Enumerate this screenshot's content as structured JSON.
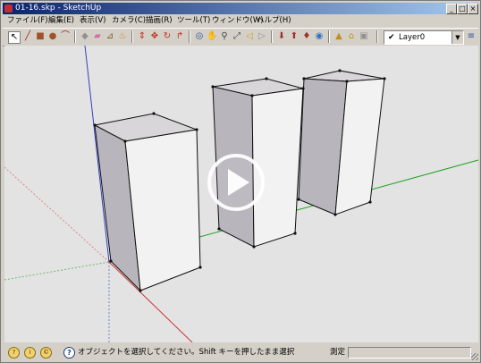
{
  "window": {
    "title": "01-16.skp - SketchUp",
    "minimize": "_",
    "maximize": "□",
    "close": "×"
  },
  "menu": {
    "items": [
      "ファイル(F)",
      "編集(E)",
      "表示(V)",
      "カメラ(C)",
      "描画(R)",
      "ツール(T)",
      "ウィンドウ(W)",
      "ヘルプ(H)"
    ]
  },
  "toolbar": {
    "tools": [
      {
        "name": "select-tool-icon",
        "glyph": "↖"
      },
      {
        "name": "pencil-tool-icon",
        "glyph": "╱"
      },
      {
        "name": "rectangle-tool-icon",
        "glyph": "■"
      },
      {
        "name": "circle-tool-icon",
        "glyph": "●"
      },
      {
        "name": "arc-tool-icon",
        "glyph": "⌒"
      },
      {
        "name": "make-component-icon",
        "glyph": "◆"
      },
      {
        "name": "eraser-tool-icon",
        "glyph": "▰"
      },
      {
        "name": "tape-measure-icon",
        "glyph": "⊿"
      },
      {
        "name": "paint-bucket-icon",
        "glyph": "♨"
      },
      {
        "name": "push-pull-icon",
        "glyph": "⇕"
      },
      {
        "name": "move-tool-icon",
        "glyph": "✥"
      },
      {
        "name": "rotate-tool-icon",
        "glyph": "↻"
      },
      {
        "name": "follow-me-icon",
        "glyph": "↱"
      },
      {
        "name": "orbit-tool-icon",
        "glyph": "◎"
      },
      {
        "name": "pan-tool-icon",
        "glyph": "✋"
      },
      {
        "name": "zoom-tool-icon",
        "glyph": "⚲"
      },
      {
        "name": "zoom-extents-icon",
        "glyph": "⤢"
      },
      {
        "name": "previous-view-icon",
        "glyph": "◁"
      },
      {
        "name": "next-view-icon",
        "glyph": "▷"
      },
      {
        "name": "get-models-icon",
        "glyph": "⬇"
      },
      {
        "name": "share-model-icon",
        "glyph": "⬆"
      },
      {
        "name": "share-component-icon",
        "glyph": "♦"
      },
      {
        "name": "google-earth-icon",
        "glyph": "◉"
      },
      {
        "name": "toggle-terrain-icon",
        "glyph": "▲"
      },
      {
        "name": "add-location-icon",
        "glyph": "⌂"
      },
      {
        "name": "photo-texture-icon",
        "glyph": "▣"
      }
    ],
    "layer": {
      "check": "✔",
      "name": "Layer0",
      "dropdown": "▼"
    },
    "layer_manager_icon": "≡"
  },
  "viewport": {
    "background_color": "#e3e3e3",
    "axis_colors": {
      "red": "#d03030",
      "green": "#20a020",
      "blue": "#3040c0"
    },
    "objects": [
      "box",
      "box",
      "box"
    ],
    "overlay": "play-button"
  },
  "status": {
    "icons": [
      "geo-location-icon",
      "credits-icon",
      "user-icon"
    ],
    "icon_glyphs": [
      "?",
      "i",
      "©"
    ],
    "help_glyph": "?",
    "message": "オブジェクトを選択してください。Shift キーを押したまま選択",
    "measurements_label": "測定",
    "measurements_value": ""
  }
}
